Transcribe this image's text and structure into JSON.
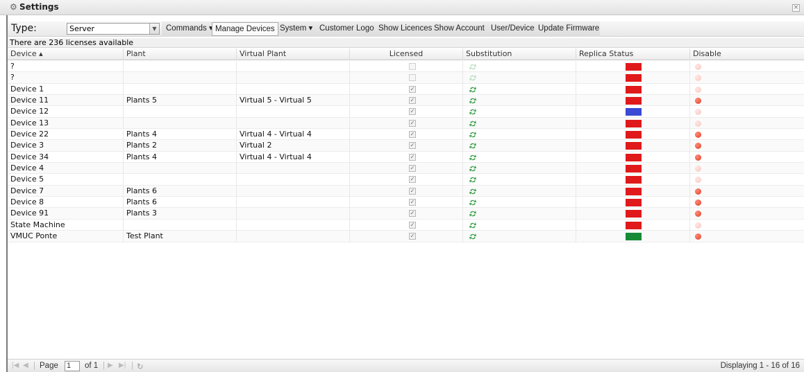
{
  "window": {
    "title": "Settings"
  },
  "toolbar": {
    "type_label": "Type:",
    "type_value": "Server",
    "buttons": [
      "Commands ▾",
      "Manage Devices",
      "System ▾",
      "Customer Logo",
      "Show Licences",
      "Show Account",
      "User/Device",
      "Update Firmware"
    ]
  },
  "info_text": "There are 236 licenses available",
  "grid": {
    "columns": [
      "Device ▴",
      "Plant",
      "Virtual Plant",
      "Licensed",
      "Substitution",
      "Replica Status",
      "Disable"
    ],
    "rows": [
      {
        "device": "?",
        "plant": "",
        "virtual": "",
        "licensed": false,
        "sub_active": false,
        "status": "#e0191b",
        "disable": false
      },
      {
        "device": "?",
        "plant": "",
        "virtual": "",
        "licensed": false,
        "sub_active": false,
        "status": "#e0191b",
        "disable": false
      },
      {
        "device": "Device 1",
        "plant": "",
        "virtual": "",
        "licensed": true,
        "sub_active": true,
        "status": "#e0191b",
        "disable": false
      },
      {
        "device": "Device 11",
        "plant": "Plants 5",
        "virtual": "Virtual 5 - Virtual 5",
        "licensed": true,
        "sub_active": true,
        "status": "#e0191b",
        "disable": true
      },
      {
        "device": "Device 12",
        "plant": "",
        "virtual": "",
        "licensed": true,
        "sub_active": true,
        "status": "#3a4ad4",
        "disable": false
      },
      {
        "device": "Device 13",
        "plant": "",
        "virtual": "",
        "licensed": true,
        "sub_active": true,
        "status": "#e0191b",
        "disable": false
      },
      {
        "device": "Device 22",
        "plant": "Plants 4",
        "virtual": "Virtual 4 - Virtual 4",
        "licensed": true,
        "sub_active": true,
        "status": "#e0191b",
        "disable": true
      },
      {
        "device": "Device 3",
        "plant": "Plants 2",
        "virtual": "Virtual 2",
        "licensed": true,
        "sub_active": true,
        "status": "#e0191b",
        "disable": true
      },
      {
        "device": "Device 34",
        "plant": "Plants 4",
        "virtual": "Virtual 4 - Virtual 4",
        "licensed": true,
        "sub_active": true,
        "status": "#e0191b",
        "disable": true
      },
      {
        "device": "Device 4",
        "plant": "",
        "virtual": "",
        "licensed": true,
        "sub_active": true,
        "status": "#e0191b",
        "disable": false
      },
      {
        "device": "Device 5",
        "plant": "",
        "virtual": "",
        "licensed": true,
        "sub_active": true,
        "status": "#e0191b",
        "disable": false
      },
      {
        "device": "Device 7",
        "plant": "Plants 6",
        "virtual": "",
        "licensed": true,
        "sub_active": true,
        "status": "#e0191b",
        "disable": true
      },
      {
        "device": "Device 8",
        "plant": "Plants 6",
        "virtual": "",
        "licensed": true,
        "sub_active": true,
        "status": "#e0191b",
        "disable": true
      },
      {
        "device": "Device 91",
        "plant": "Plants 3",
        "virtual": "",
        "licensed": true,
        "sub_active": true,
        "status": "#e0191b",
        "disable": true
      },
      {
        "device": "State Machine",
        "plant": "",
        "virtual": "",
        "licensed": true,
        "sub_active": true,
        "status": "#e0191b",
        "disable": false
      },
      {
        "device": "VMUC Ponte",
        "plant": "Test Plant",
        "virtual": "",
        "licensed": true,
        "sub_active": true,
        "status": "#178a37",
        "disable": true
      }
    ]
  },
  "pager": {
    "page_label": "Page",
    "page_value": "1",
    "of_label": "of 1",
    "display_text": "Displaying 1 - 16 of 16"
  },
  "icons": {
    "settings": "gear-icon",
    "close": "close-icon",
    "substitution": "recycle-arrows-icon",
    "disable": "red-dot-icon",
    "first": "first-page-icon",
    "prev": "prev-page-icon",
    "next": "next-page-icon",
    "last": "last-page-icon",
    "refresh": "refresh-icon"
  }
}
